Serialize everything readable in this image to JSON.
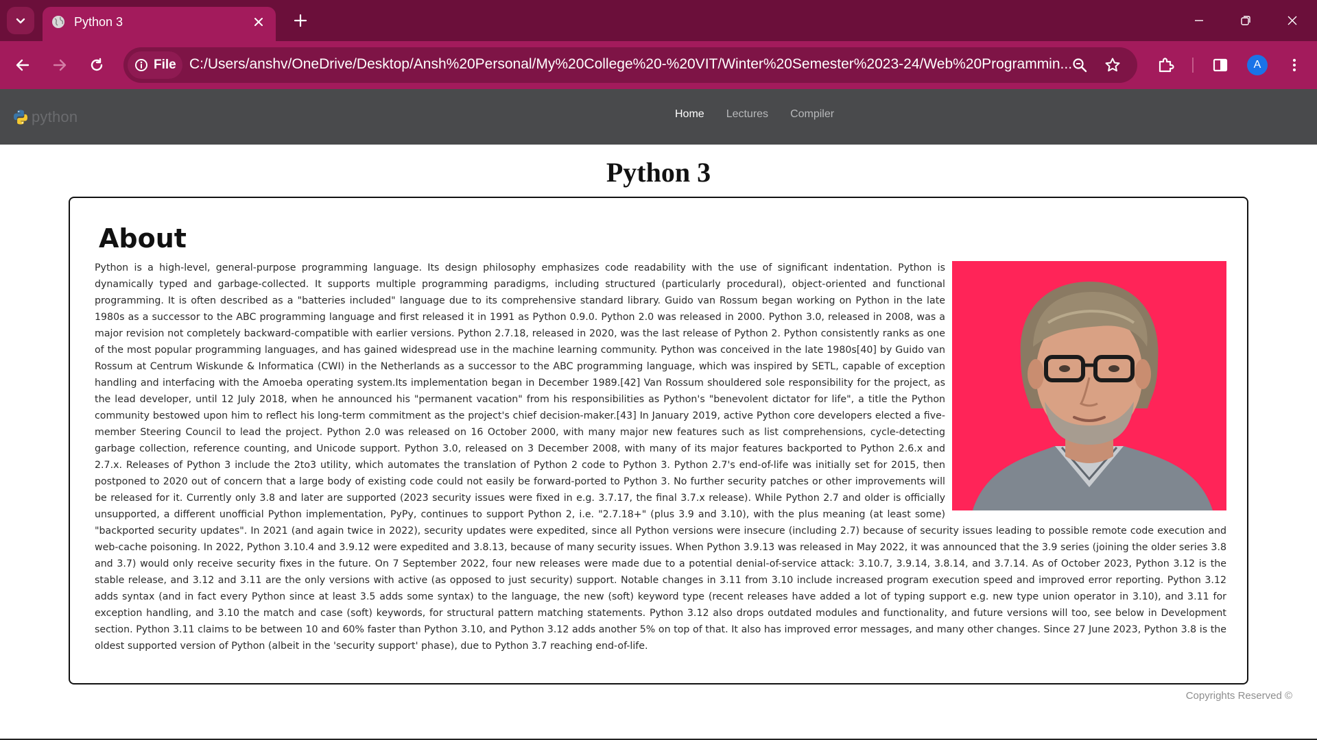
{
  "browser": {
    "tab": {
      "title": "Python 3"
    },
    "address": {
      "chip_label": "File",
      "url": "C:/Users/anshv/OneDrive/Desktop/Ansh%20Personal/My%20College%20-%20VIT/Winter%20Semester%2023-24/Web%20Programmin..."
    },
    "profile_initial": "A"
  },
  "site": {
    "brand": "python",
    "nav": {
      "home": "Home",
      "lectures": "Lectures",
      "compiler": "Compiler"
    }
  },
  "page": {
    "title": "Python 3",
    "about": {
      "heading": "About",
      "paragraph": "Python is a high-level, general-purpose programming language. Its design philosophy emphasizes code readability with the use of significant indentation. Python is dynamically typed and garbage-collected. It supports multiple programming paradigms, including structured (particularly procedural), object-oriented and functional programming. It is often described as a \"batteries included\" language due to its comprehensive standard library. Guido van Rossum began working on Python in the late 1980s as a successor to the ABC programming language and first released it in 1991 as Python 0.9.0. Python 2.0 was released in 2000. Python 3.0, released in 2008, was a major revision not completely backward-compatible with earlier versions. Python 2.7.18, released in 2020, was the last release of Python 2. Python consistently ranks as one of the most popular programming languages, and has gained widespread use in the machine learning community. Python was conceived in the late 1980s[40] by Guido van Rossum at Centrum Wiskunde & Informatica (CWI) in the Netherlands as a successor to the ABC programming language, which was inspired by SETL, capable of exception handling and interfacing with the Amoeba operating system.Its implementation began in December 1989.[42] Van Rossum shouldered sole responsibility for the project, as the lead developer, until 12 July 2018, when he announced his \"permanent vacation\" from his responsibilities as Python's \"benevolent dictator for life\", a title the Python community bestowed upon him to reflect his long-term commitment as the project's chief decision-maker.[43] In January 2019, active Python core developers elected a five-member Steering Council to lead the project. Python 2.0 was released on 16 October 2000, with many major new features such as list comprehensions, cycle-detecting garbage collection, reference counting, and Unicode support. Python 3.0, released on 3 December 2008, with many of its major features backported to Python 2.6.x and 2.7.x. Releases of Python 3 include the 2to3 utility, which automates the translation of Python 2 code to Python 3. Python 2.7's end-of-life was initially set for 2015, then postponed to 2020 out of concern that a large body of existing code could not easily be forward-ported to Python 3. No further security patches or other improvements will be released for it. Currently only 3.8 and later are supported (2023 security issues were fixed in e.g. 3.7.17, the final 3.7.x release). While Python 2.7 and older is officially unsupported, a different unofficial Python implementation, PyPy, continues to support Python 2, i.e. \"2.7.18+\" (plus 3.9 and 3.10), with the plus meaning (at least some) \"backported security updates\". In 2021 (and again twice in 2022), security updates were expedited, since all Python versions were insecure (including 2.7) because of security issues leading to possible remote code execution and web-cache poisoning. In 2022, Python 3.10.4 and 3.9.12 were expedited and 3.8.13, because of many security issues. When Python 3.9.13 was released in May 2022, it was announced that the 3.9 series (joining the older series 3.8 and 3.7) would only receive security fixes in the future. On 7 September 2022, four new releases were made due to a potential denial-of-service attack: 3.10.7, 3.9.14, 3.8.14, and 3.7.14. As of October 2023, Python 3.12 is the stable release, and 3.12 and 3.11 are the only versions with active (as opposed to just security) support. Notable changes in 3.11 from 3.10 include increased program execution speed and improved error reporting. Python 3.12 adds syntax (and in fact every Python since at least 3.5 adds some syntax) to the language, the new (soft) keyword type (recent releases have added a lot of typing support e.g. new type union operator in 3.10), and 3.11 for exception handling, and 3.10 the match and case (soft) keywords, for structural pattern matching statements. Python 3.12 also drops outdated modules and functionality, and future versions will too, see below in Development section. Python 3.11 claims to be between 10 and 60% faster than Python 3.10, and Python 3.12 adds another 5% on top of that. It also has improved error messages, and many other changes. Since 27 June 2023, Python 3.8 is the oldest supported version of Python (albeit in the 'security support' phase), due to Python 3.7 reaching end-of-life."
    },
    "footer": "Copyrights Reserved ©"
  },
  "colors": {
    "tabstrip": "#6b0f3a",
    "toolbar": "#a31b5c",
    "navbar": "#494a4c",
    "portrait_bg": "#ff2458"
  }
}
